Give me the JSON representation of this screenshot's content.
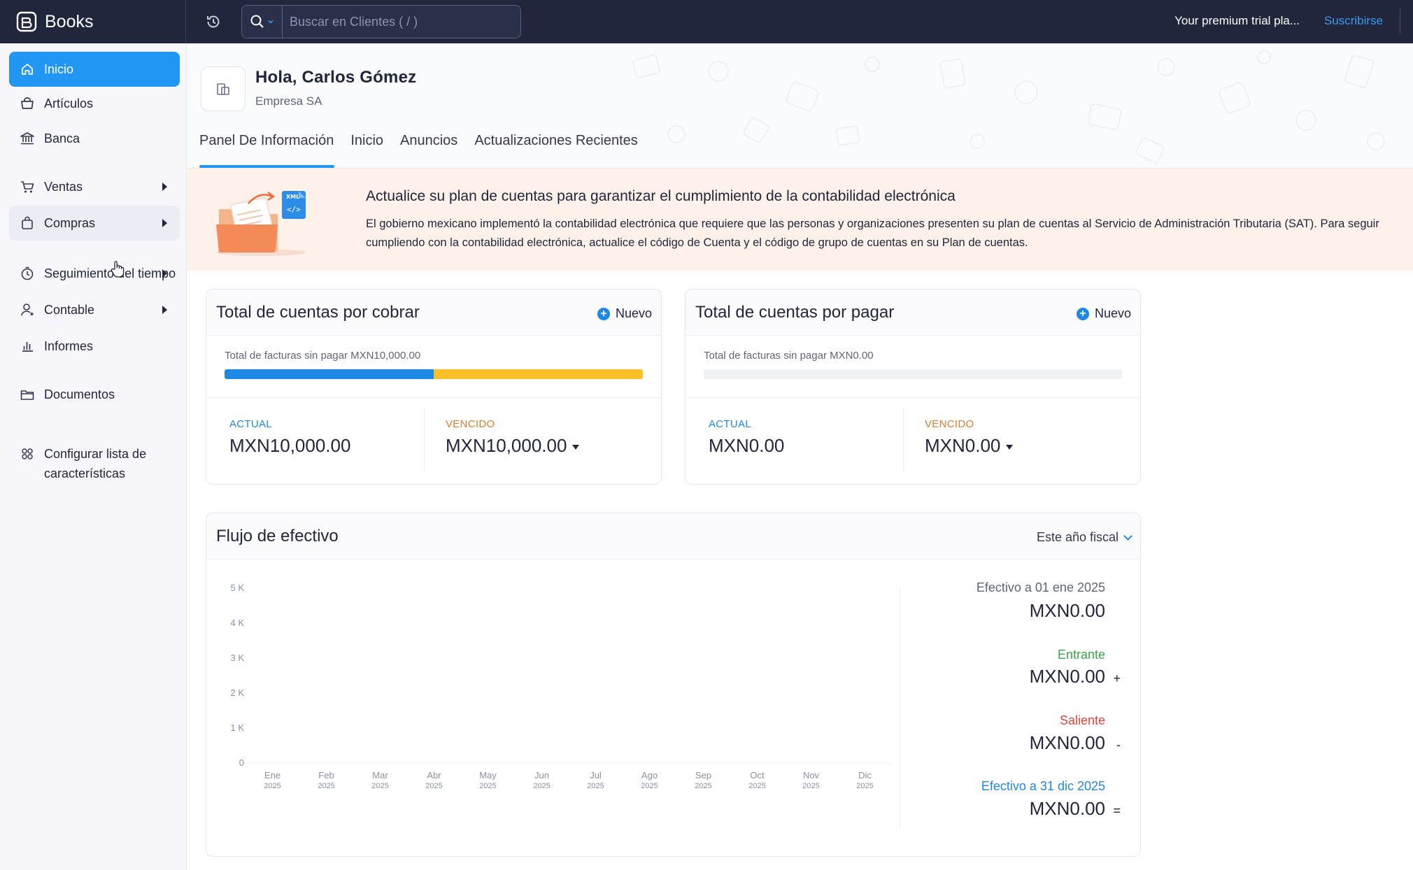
{
  "app": {
    "brand": "Books",
    "search_placeholder": "Buscar en Clientes ( / )",
    "trial_text": "Your premium trial pla...",
    "subscribe_label": "Suscribirse"
  },
  "sidebar": {
    "items": [
      {
        "label": "Inicio",
        "icon": "home-icon"
      },
      {
        "label": "Artículos",
        "icon": "basket-icon"
      },
      {
        "label": "Banca",
        "icon": "bank-icon"
      },
      {
        "label": "Ventas",
        "icon": "cart-icon"
      },
      {
        "label": "Compras",
        "icon": "bag-icon"
      },
      {
        "label": "Seguimiento del tiempo",
        "icon": "clock-icon"
      },
      {
        "label": "Contable",
        "icon": "accountant-icon"
      },
      {
        "label": "Informes",
        "icon": "bar-chart-icon"
      },
      {
        "label": "Documentos",
        "icon": "folder-icon"
      },
      {
        "label": "Configurar lista de características",
        "icon": "features-icon"
      }
    ]
  },
  "header": {
    "greeting": "Hola, Carlos Gómez",
    "org": "Empresa SA",
    "tabs": [
      "Panel De Información",
      "Inicio",
      "Anuncios",
      "Actualizaciones Recientes"
    ]
  },
  "banner": {
    "title": "Actualice su plan de cuentas para garantizar el cumplimiento de la contabilidad electrónica",
    "text": "El gobierno mexicano implementó la contabilidad electrónica que requiere que las personas y organizaciones presenten su plan de cuentas al Servicio de Administración Tributaria (SAT). Para seguir cumpliendo con la contabilidad electrónica, actualice el código de Cuenta y el código de grupo de cuentas en su Plan de cuentas.",
    "illustration_text": "XML"
  },
  "receivables": {
    "title": "Total de cuentas por cobrar",
    "new_label": "Nuevo",
    "unpaid_label": "Total de facturas sin pagar MXN10,000.00",
    "current_fraction": 0.5,
    "overdue_fraction": 0.5,
    "current_label": "ACTUAL",
    "current_value": "MXN10,000.00",
    "overdue_label": "VENCIDO",
    "overdue_value": "MXN10,000.00"
  },
  "payables": {
    "title": "Total de cuentas por pagar",
    "new_label": "Nuevo",
    "unpaid_label": "Total de facturas sin pagar MXN0.00",
    "current_fraction": 0,
    "overdue_fraction": 0,
    "current_label": "ACTUAL",
    "current_value": "MXN0.00",
    "overdue_label": "VENCIDO",
    "overdue_value": "MXN0.00"
  },
  "cashflow": {
    "title": "Flujo de efectivo",
    "period": "Este año fiscal",
    "opening_label": "Efectivo a 01 ene 2025",
    "opening_value": "MXN0.00",
    "incoming_label": "Entrante",
    "incoming_value": "MXN0.00",
    "incoming_op": "+",
    "outgoing_label": "Saliente",
    "outgoing_value": "MXN0.00",
    "outgoing_op": "-",
    "closing_label": "Efectivo a 31 dic 2025",
    "closing_value": "MXN0.00",
    "closing_op": "="
  },
  "colors": {
    "accent": "#2196f3",
    "topbar": "#21263c",
    "actual": "#1e88e5",
    "vencido": "#e07b2a",
    "incoming": "#3aa34a",
    "outgoing": "#d9453d",
    "closing": "#1e88e5",
    "bar_yellow": "#fbbf2a"
  },
  "chart_data": {
    "type": "line",
    "title": "",
    "x": [
      "Ene 2025",
      "Feb 2025",
      "Mar 2025",
      "Abr 2025",
      "May 2025",
      "Jun 2025",
      "Jul 2025",
      "Ago 2025",
      "Sep 2025",
      "Oct 2025",
      "Nov 2025",
      "Dic 2025"
    ],
    "x_month": [
      "Ene",
      "Feb",
      "Mar",
      "Abr",
      "May",
      "Jun",
      "Jul",
      "Ago",
      "Sep",
      "Oct",
      "Nov",
      "Dic"
    ],
    "x_year": "2025",
    "y_ticks": [
      "0",
      "1 K",
      "2 K",
      "3 K",
      "4 K",
      "5 K"
    ],
    "series": [
      {
        "values": [
          0,
          0,
          0,
          0,
          0,
          0,
          0,
          0,
          0,
          0,
          0,
          0
        ]
      }
    ],
    "ylim": [
      0,
      5000
    ],
    "xlabel": "",
    "ylabel": "",
    "grid": false
  }
}
